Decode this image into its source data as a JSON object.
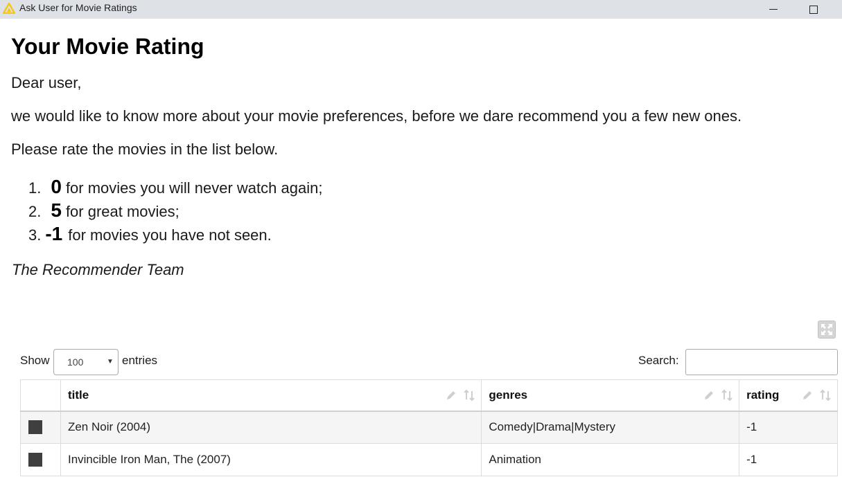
{
  "window": {
    "title": "Ask User for Movie Ratings"
  },
  "content": {
    "heading": "Your Movie Rating",
    "greeting": "Dear user,",
    "intro": "we would like to know more about your movie preferences, before we dare recommend you a few new ones.",
    "instruction": "Please rate the movies in the list below.",
    "list": [
      {
        "num": "1.",
        "value": "0",
        "text": "for movies you will never watch again;"
      },
      {
        "num": "2.",
        "value": "5",
        "text": "for great movies;"
      },
      {
        "num": "3.",
        "value": "-1",
        "text": "for movies you have not seen."
      }
    ],
    "signature": "The Recommender Team"
  },
  "controls": {
    "show_label": "Show",
    "entries_value": "100",
    "entries_label": "entries",
    "search_label": "Search:",
    "search_value": ""
  },
  "table": {
    "columns": [
      "title",
      "genres",
      "rating"
    ],
    "rows": [
      {
        "title": "Zen Noir (2004)",
        "genres": "Comedy|Drama|Mystery",
        "rating": "-1"
      },
      {
        "title": "Invincible Iron Man, The (2007)",
        "genres": "Animation",
        "rating": "-1"
      }
    ]
  },
  "colors": {
    "titlebar_bg": "#dee1e6",
    "app_icon": "#f5c518",
    "checkbox": "#3f3f3f",
    "row_stripe": "#f5f5f5"
  },
  "icons": {
    "app": "knime-triangle-icon",
    "minimize": "minimize-icon",
    "maximize": "maximize-icon",
    "expand": "fullscreen-expand-icon",
    "edit": "pencil-icon",
    "sort": "sort-arrows-icon"
  }
}
